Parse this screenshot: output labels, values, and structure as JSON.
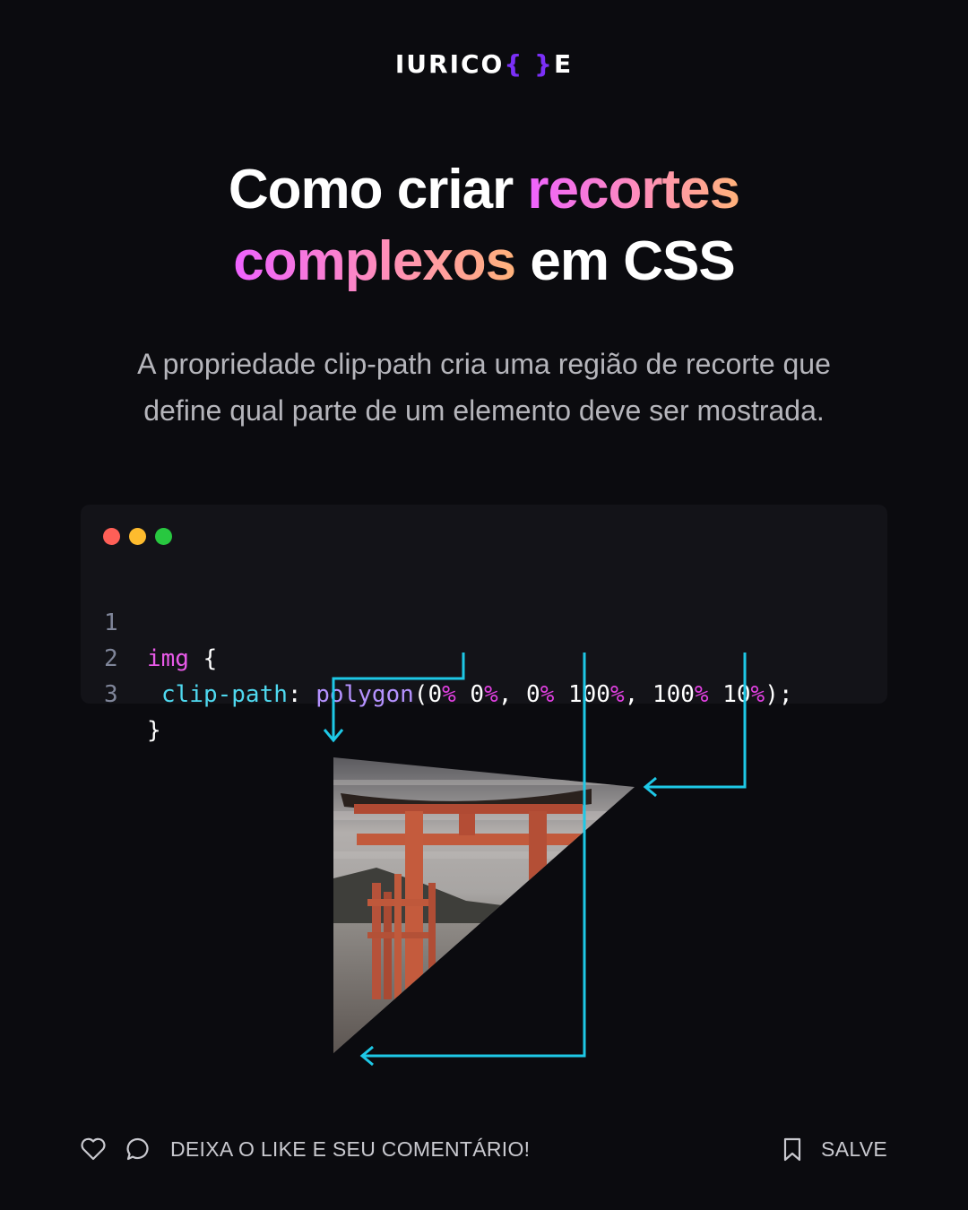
{
  "logo": {
    "part1": "IURICO",
    "brace_open": "{",
    "brace_close": "}",
    "part2": "E"
  },
  "title": {
    "line1_plain": "Como criar ",
    "line1_highlight": "recortes",
    "line2_highlight": "complexos",
    "line2_plain": " em CSS"
  },
  "subtitle": "A propriedade clip-path cria uma região de recorte que define qual parte de um elemento deve ser mostrada.",
  "code": {
    "lines": [
      {
        "number": "1",
        "selector": "img",
        "brace": " {"
      },
      {
        "number": "2",
        "property": "clip-path",
        "colon": ": ",
        "function": "polygon",
        "open_paren": "(",
        "n1": "0",
        "p1": "%",
        "sp1": " ",
        "n2": "0",
        "p2": "%",
        "sep1": ", ",
        "n3": "0",
        "p3": "%",
        "sp2": " ",
        "n4": "100",
        "p4": "%",
        "sep2": ", ",
        "n5": "100",
        "p5": "%",
        "sp3": " ",
        "n6": "10",
        "p6": "%",
        "close": ");"
      },
      {
        "number": "3",
        "brace": "}"
      }
    ]
  },
  "colors": {
    "background": "#0b0b0f",
    "code_background": "#131318",
    "arrow": "#1ec8e6",
    "gradient_start": "#ee62ff",
    "gradient_end": "#ffb27a",
    "brace_accent": "#7b2ff7"
  },
  "image": {
    "subject": "torii-gate-clipped-triangle"
  },
  "footer": {
    "cta": "DEIXA O LIKE E SEU COMENTÁRIO!",
    "save": "SALVE",
    "icons": [
      "heart-icon",
      "comment-icon",
      "bookmark-icon"
    ]
  }
}
